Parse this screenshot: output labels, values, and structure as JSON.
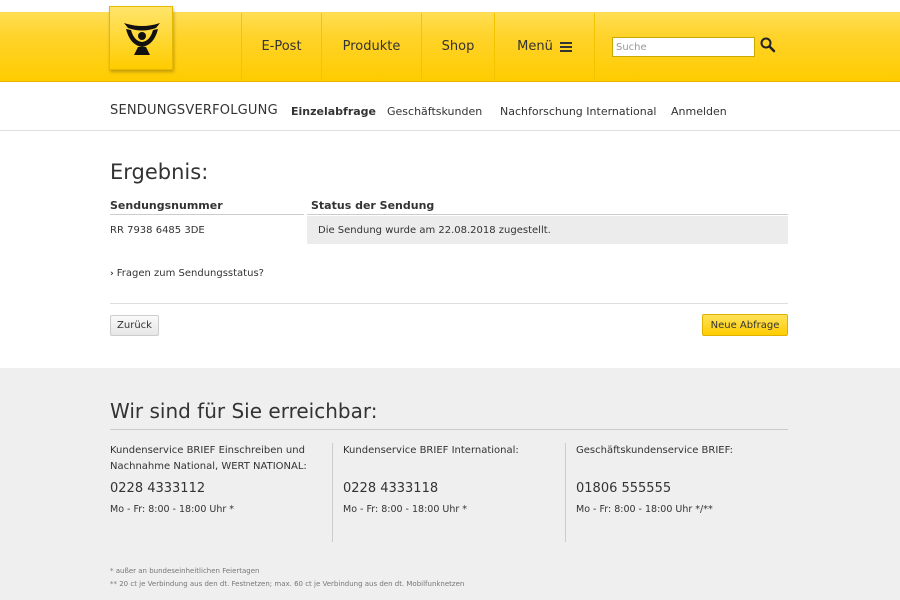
{
  "header": {
    "logo_alt": "Deutsche Post",
    "nav": [
      "E-Post",
      "Produkte",
      "Shop",
      "Menü"
    ],
    "search_placeholder": "Suche"
  },
  "subnav": {
    "title": "SENDUNGSVERFOLGUNG",
    "links": [
      "Einzelabfrage",
      "Geschäftskunden",
      "Nachforschung International",
      "Anmelden"
    ],
    "active": "Einzelabfrage"
  },
  "result": {
    "title": "Ergebnis:",
    "col_number": "Sendungsnummer",
    "col_status": "Status der Sendung",
    "number": "RR 7938 6485 3DE",
    "status": "Die Sendung wurde am 22.08.2018 zugestellt.",
    "faq": "Fragen zum Sendungsstatus?",
    "back_label": "Zurück",
    "new_label": "Neue Abfrage"
  },
  "footer": {
    "title": "Wir sind für Sie erreichbar:",
    "columns": [
      {
        "name": "Kundenservice BRIEF Einschreiben und Nachnahme National, WERT NATIONAL:",
        "phone": "0228 4333112",
        "hours": "Mo - Fr: 8:00 - 18:00 Uhr *"
      },
      {
        "name": "Kundenservice BRIEF International:",
        "phone": "0228 4333118",
        "hours": "Mo - Fr: 8:00 - 18:00 Uhr *"
      },
      {
        "name": "Geschäftskundenservice BRIEF:",
        "phone": "01806 555555",
        "hours": "Mo - Fr: 8:00 - 18:00 Uhr */**"
      }
    ],
    "note1": "* außer an bundeseinheitlichen Feiertagen",
    "note2": "** 20 ct je Verbindung aus den dt. Festnetzen; max. 60 ct je Verbindung aus den dt. Mobilfunknetzen"
  },
  "colors": {
    "brand_yellow": "#ffcc00",
    "text": "#333333",
    "footer_bg": "#efefef"
  },
  "icons": {
    "logo": "post-horn-icon",
    "menu": "hamburger-icon",
    "search": "search-icon",
    "chevron": "chevron-right-icon"
  }
}
